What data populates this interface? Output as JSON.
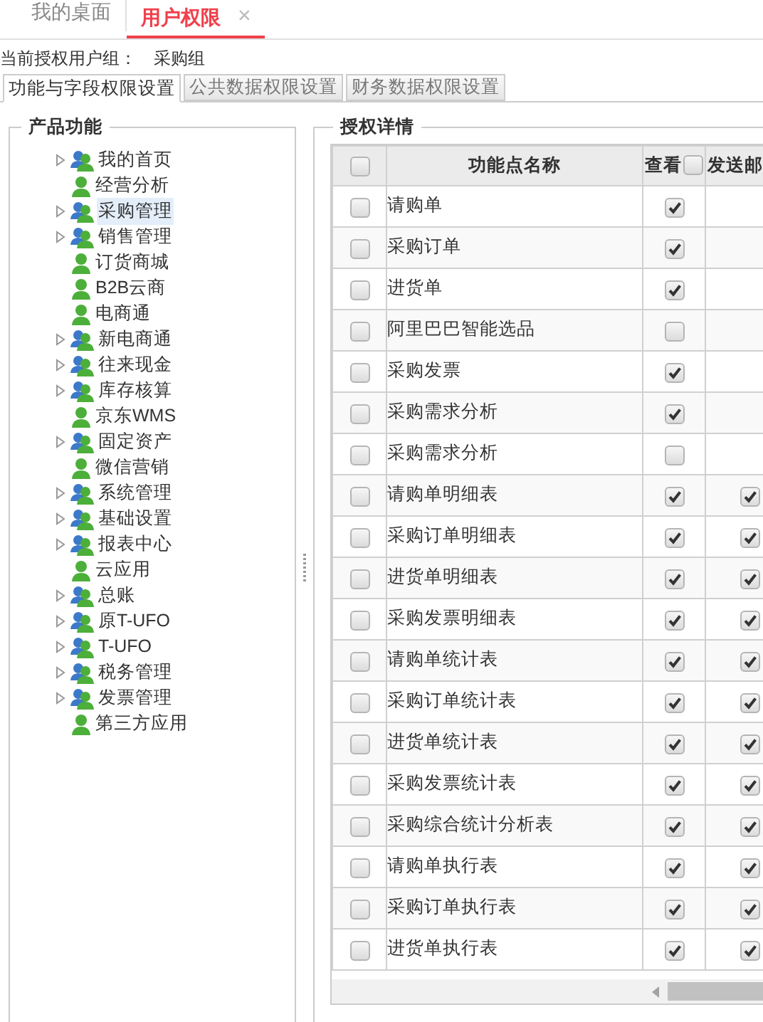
{
  "top_tabs": [
    {
      "label": "我的桌面",
      "selected": false,
      "closable": false
    },
    {
      "label": "用户权限",
      "selected": true,
      "closable": true
    }
  ],
  "close_glyph": "×",
  "group_label": "当前授权用户组：",
  "group_value": "采购组",
  "sub_tabs": [
    {
      "label": "功能与字段权限设置",
      "selected": true
    },
    {
      "label": "公共数据权限设置",
      "selected": false
    },
    {
      "label": "财务数据权限设置",
      "selected": false
    }
  ],
  "tree": {
    "title": "产品功能",
    "items": [
      {
        "label": "我的首页",
        "kind": "group",
        "expandable": true,
        "selected": false
      },
      {
        "label": "经营分析",
        "kind": "user",
        "expandable": false,
        "selected": false
      },
      {
        "label": "采购管理",
        "kind": "group",
        "expandable": true,
        "selected": true
      },
      {
        "label": "销售管理",
        "kind": "group",
        "expandable": true,
        "selected": false
      },
      {
        "label": "订货商城",
        "kind": "user",
        "expandable": false,
        "selected": false
      },
      {
        "label": "B2B云商",
        "kind": "user",
        "expandable": false,
        "selected": false
      },
      {
        "label": "电商通",
        "kind": "user",
        "expandable": false,
        "selected": false
      },
      {
        "label": "新电商通",
        "kind": "group",
        "expandable": true,
        "selected": false
      },
      {
        "label": "往来现金",
        "kind": "group",
        "expandable": true,
        "selected": false
      },
      {
        "label": "库存核算",
        "kind": "group",
        "expandable": true,
        "selected": false
      },
      {
        "label": "京东WMS",
        "kind": "user",
        "expandable": false,
        "selected": false
      },
      {
        "label": "固定资产",
        "kind": "group",
        "expandable": true,
        "selected": false
      },
      {
        "label": "微信营销",
        "kind": "user",
        "expandable": false,
        "selected": false
      },
      {
        "label": "系统管理",
        "kind": "group",
        "expandable": true,
        "selected": false
      },
      {
        "label": "基础设置",
        "kind": "group",
        "expandable": true,
        "selected": false
      },
      {
        "label": "报表中心",
        "kind": "group",
        "expandable": true,
        "selected": false
      },
      {
        "label": "云应用",
        "kind": "user",
        "expandable": false,
        "selected": false
      },
      {
        "label": "总账",
        "kind": "group",
        "expandable": true,
        "selected": false
      },
      {
        "label": "原T-UFO",
        "kind": "group",
        "expandable": true,
        "selected": false
      },
      {
        "label": "T-UFO",
        "kind": "group",
        "expandable": true,
        "selected": false
      },
      {
        "label": "税务管理",
        "kind": "group",
        "expandable": true,
        "selected": false
      },
      {
        "label": "发票管理",
        "kind": "group",
        "expandable": true,
        "selected": false
      },
      {
        "label": "第三方应用",
        "kind": "user",
        "expandable": false,
        "selected": false
      }
    ]
  },
  "details": {
    "title": "授权详情",
    "columns": {
      "select_all_checked": false,
      "name": "功能点名称",
      "view": "查看",
      "view_all_checked": false,
      "mail": "发送邮"
    },
    "rows": [
      {
        "name": "请购单",
        "checked": false,
        "view_checked": true
      },
      {
        "name": "采购订单",
        "checked": false,
        "view_checked": true
      },
      {
        "name": "进货单",
        "checked": false,
        "view_checked": true
      },
      {
        "name": "阿里巴巴智能选品",
        "checked": false,
        "view_checked": false
      },
      {
        "name": "采购发票",
        "checked": false,
        "view_checked": true
      },
      {
        "name": "采购需求分析",
        "checked": false,
        "view_checked": true
      },
      {
        "name": "采购需求分析",
        "checked": false,
        "view_checked": false
      },
      {
        "name": "请购单明细表",
        "checked": false,
        "view_checked": true,
        "mail_checked": true
      },
      {
        "name": "采购订单明细表",
        "checked": false,
        "view_checked": true,
        "mail_checked": true
      },
      {
        "name": "进货单明细表",
        "checked": false,
        "view_checked": true,
        "mail_checked": true
      },
      {
        "name": "采购发票明细表",
        "checked": false,
        "view_checked": true,
        "mail_checked": true
      },
      {
        "name": "请购单统计表",
        "checked": false,
        "view_checked": true,
        "mail_checked": true
      },
      {
        "name": "采购订单统计表",
        "checked": false,
        "view_checked": true,
        "mail_checked": true
      },
      {
        "name": "进货单统计表",
        "checked": false,
        "view_checked": true,
        "mail_checked": true
      },
      {
        "name": "采购发票统计表",
        "checked": false,
        "view_checked": true,
        "mail_checked": true
      },
      {
        "name": "采购综合统计分析表",
        "checked": false,
        "view_checked": true,
        "mail_checked": true
      },
      {
        "name": "请购单执行表",
        "checked": false,
        "view_checked": true,
        "mail_checked": true
      },
      {
        "name": "采购订单执行表",
        "checked": false,
        "view_checked": true,
        "mail_checked": true
      },
      {
        "name": "进货单执行表",
        "checked": false,
        "view_checked": true,
        "mail_checked": true
      }
    ]
  }
}
